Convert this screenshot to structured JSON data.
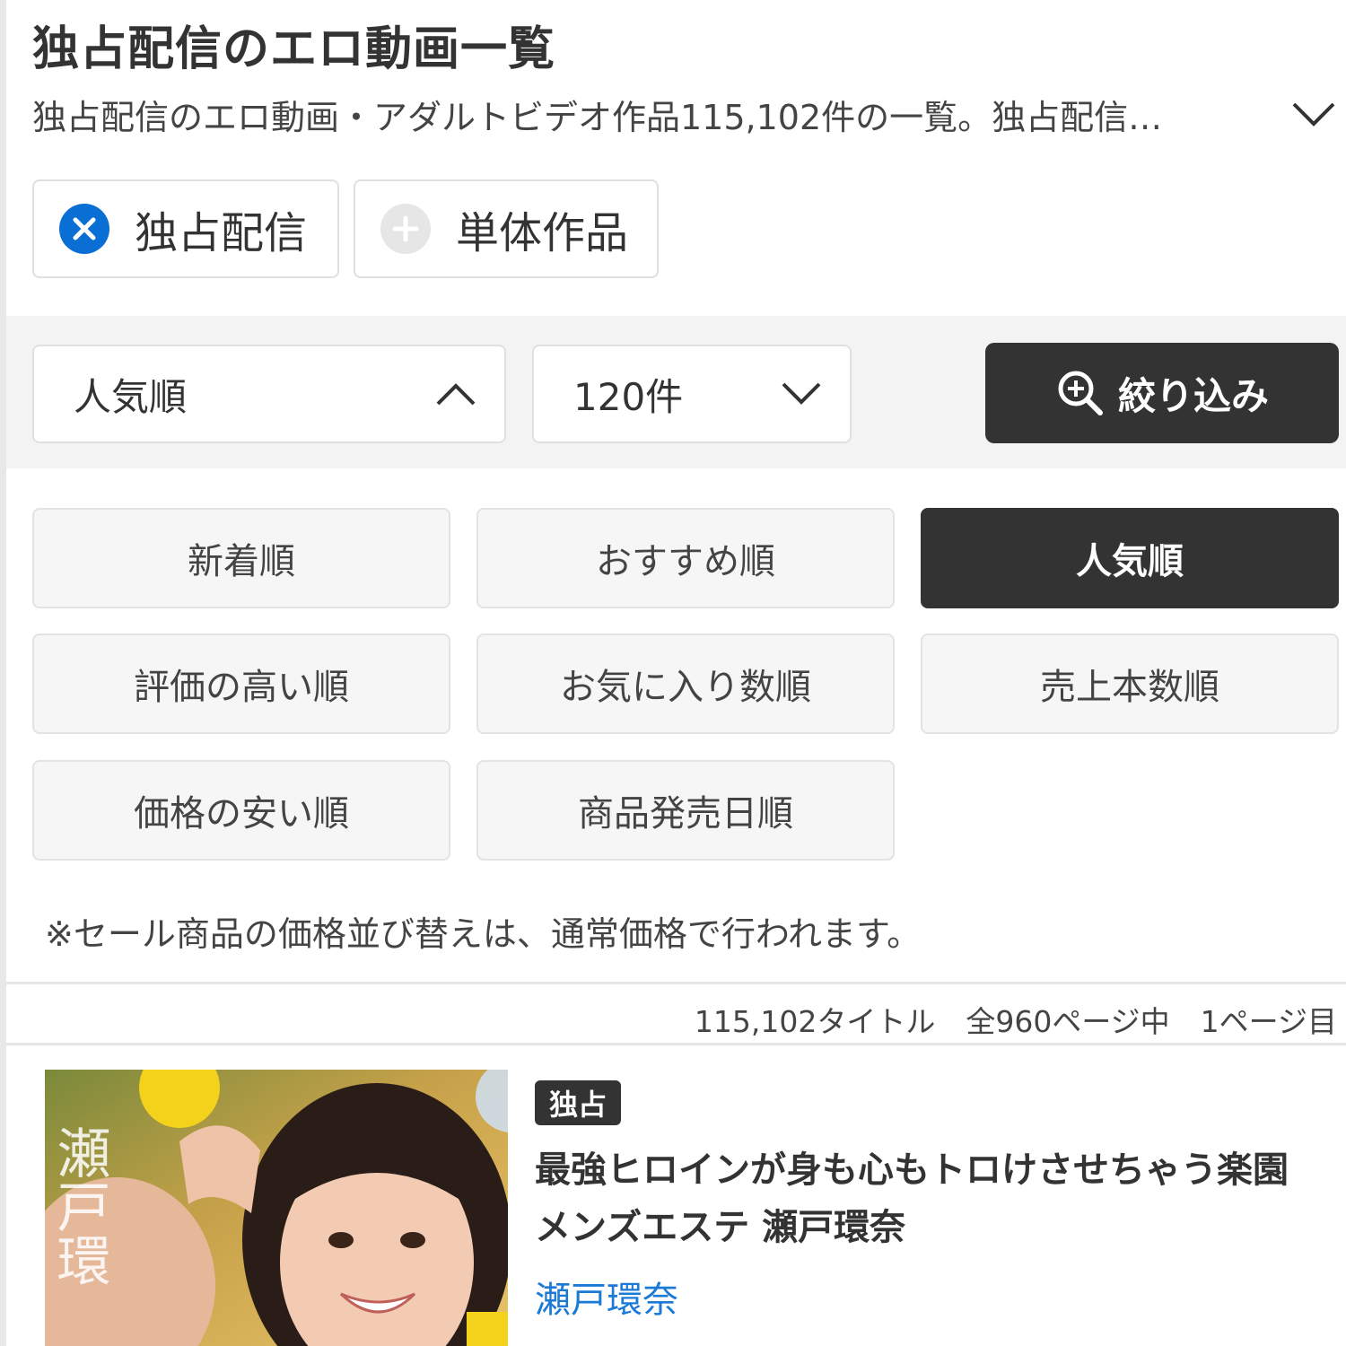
{
  "header": {
    "title": "独占配信のエロ動画一覧",
    "description": "独占配信のエロ動画・アダルトビデオ作品115,102件の一覧。独占配信…"
  },
  "filter_chips": [
    {
      "label": "独占配信",
      "state": "selected",
      "icon": "close-icon"
    },
    {
      "label": "単体作品",
      "state": "unselected",
      "icon": "plus-icon"
    }
  ],
  "toolbar": {
    "sort_value": "人気順",
    "per_page_value": "120件",
    "filter_label": "絞り込み"
  },
  "sort_options": [
    "新着順",
    "おすすめ順",
    "人気順",
    "評価の高い順",
    "お気に入り数順",
    "売上本数順",
    "価格の安い順",
    "商品発売日順"
  ],
  "sort_active": "人気順",
  "sale_note": "※セール商品の価格並び替えは、通常価格で行われます。",
  "result_info": {
    "total": "115,102タイトル",
    "pages": "全960ページ中",
    "current": "1ページ目"
  },
  "item": {
    "badge": "独占",
    "title": "最強ヒロインが身も心もトロけさせちゃう楽園メンズエステ 瀬戸環奈",
    "actress": "瀬戸環奈",
    "thumbnail_text": "瀬戸環"
  },
  "colors": {
    "accent_blue": "#0a6fd4",
    "dark_button": "#333333",
    "link_blue": "#1a7ad6"
  }
}
